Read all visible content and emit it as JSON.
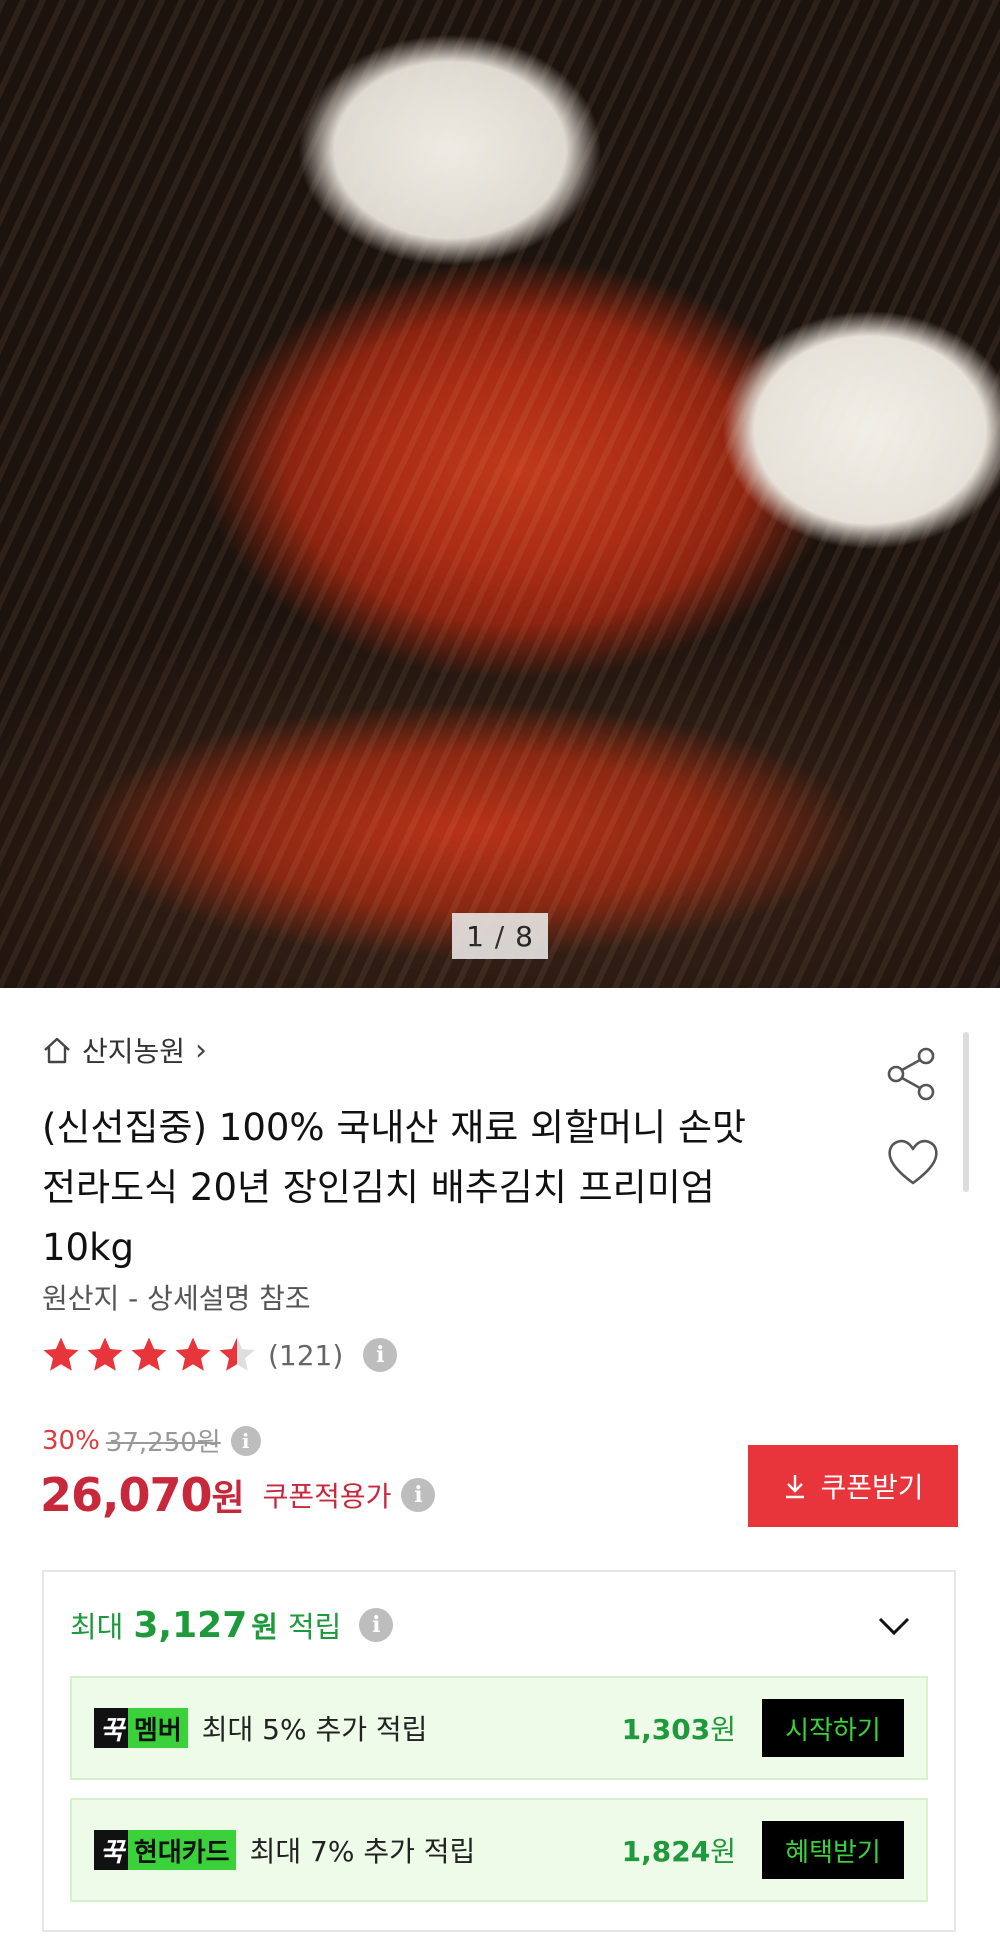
{
  "gallery": {
    "pager": "1 / 8"
  },
  "store": {
    "name": "산지농원",
    "chevron": "›"
  },
  "product": {
    "title": "(신선집중) 100% 국내산 재료 외할머니 손맛 전라도식 20년 장인김치 배추김치 프리미엄 10kg",
    "origin": "원산지 - 상세설명 참조"
  },
  "rating": {
    "stars": 4.5,
    "count": "(121)"
  },
  "price": {
    "discount": "30%",
    "original": "37,250원",
    "current": "26,070",
    "won": "원",
    "coupon_label": "쿠폰적용가",
    "coupon_button": "쿠폰받기",
    "info_glyph": "i"
  },
  "points": {
    "prefix": "최대",
    "amount": "3,127",
    "unit": "원",
    "suffix": "적립",
    "rows": [
      {
        "badge_mark": "꾹",
        "badge_name": "멤버",
        "text": "최대 5% 추가 적립",
        "amount": "1,303",
        "unit": "원",
        "button": "시작하기"
      },
      {
        "badge_mark": "꾹",
        "badge_name": "현대카드",
        "text": "최대 7% 추가 적립",
        "amount": "1,824",
        "unit": "원",
        "button": "혜택받기"
      }
    ]
  },
  "colors": {
    "accent_red": "#e8343b",
    "price_red": "#c8283c",
    "points_green": "#1e9a3c",
    "badge_green": "#3ad13a"
  },
  "icons": [
    "home-icon",
    "chevron-right-icon",
    "share-icon",
    "heart-icon",
    "star-icon",
    "info-icon",
    "download-icon",
    "chevron-down-icon"
  ]
}
